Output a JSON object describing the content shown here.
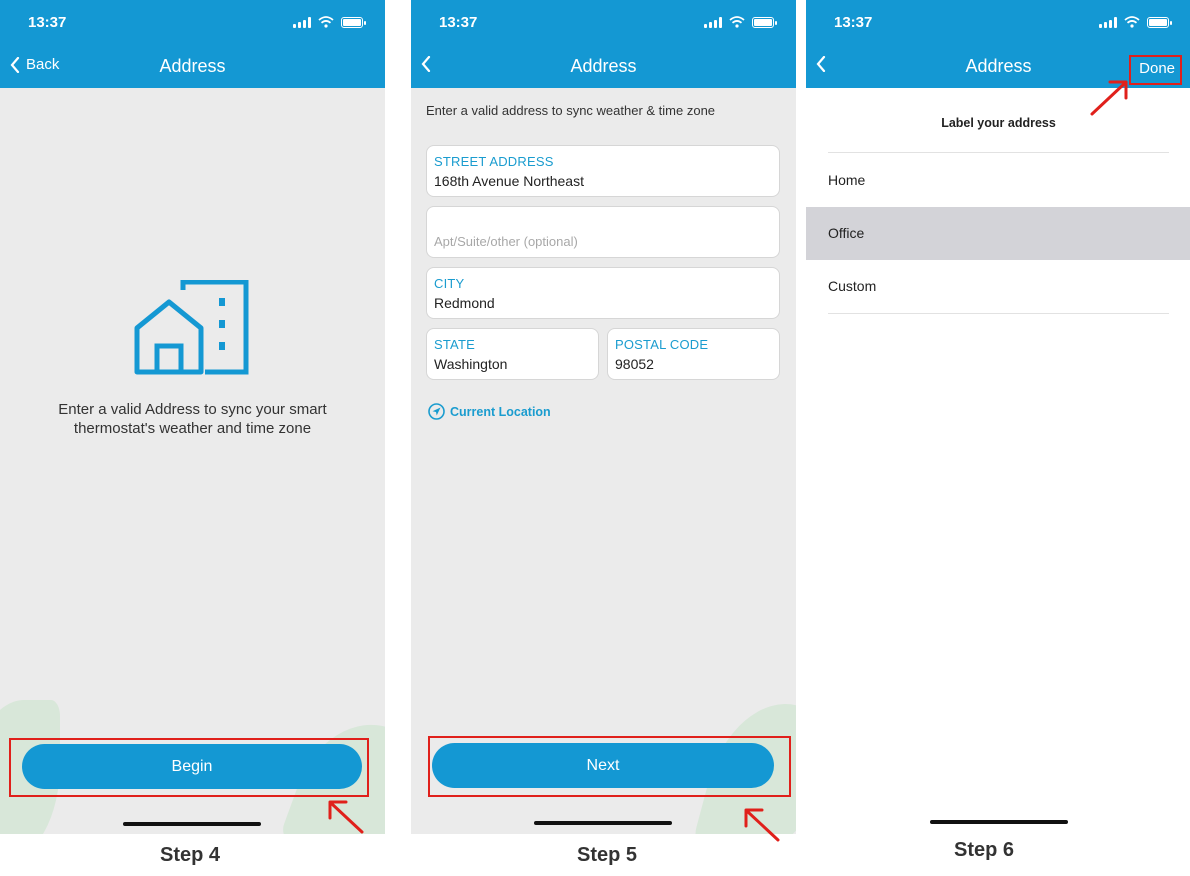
{
  "status_time": "13:37",
  "nav_title": "Address",
  "panel1": {
    "back_label": "Back",
    "description": "Enter a valid Address to sync your smart thermostat's weather and time zone",
    "button_label": "Begin"
  },
  "panel2": {
    "instruction": "Enter a valid address to sync weather & time zone",
    "street": {
      "label": "STREET ADDRESS",
      "value": "168th Avenue Northeast"
    },
    "apt": {
      "placeholder": "Apt/Suite/other (optional)"
    },
    "city": {
      "label": "CITY",
      "value": "Redmond"
    },
    "state": {
      "label": "STATE",
      "value": "Washington"
    },
    "postal": {
      "label": "POSTAL CODE",
      "value": "98052"
    },
    "current_location": "Current Location",
    "button_label": "Next"
  },
  "panel3": {
    "done_label": "Done",
    "heading": "Label your address",
    "options": [
      "Home",
      "Office",
      "Custom"
    ],
    "selected_option": "Office"
  },
  "steps": [
    "Step 4",
    "Step 5",
    "Step 6"
  ],
  "colors": {
    "brand_blue": "#1498d3",
    "highlight_red": "#e0201b",
    "field_label": "#1a9ccf"
  }
}
